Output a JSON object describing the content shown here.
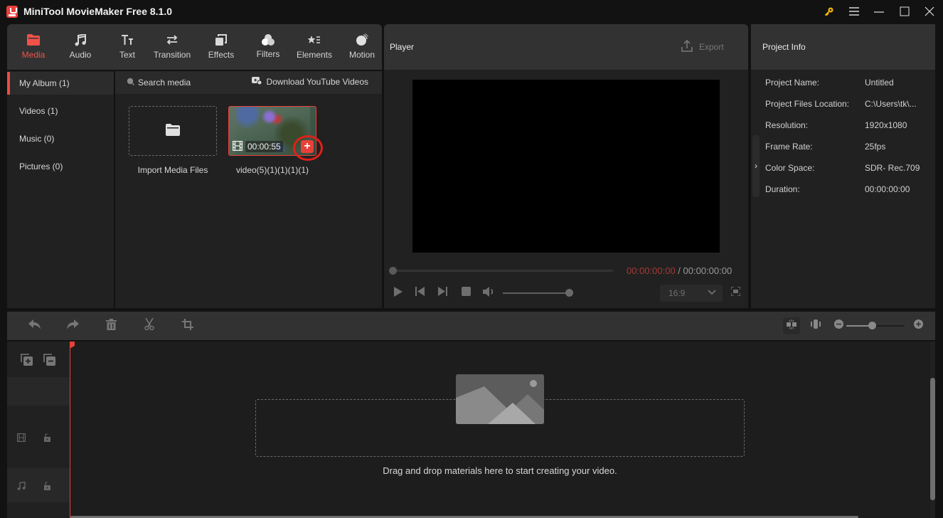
{
  "window": {
    "title": "MiniTool MovieMaker Free 8.1.0",
    "controls": [
      "key-icon",
      "menu-icon",
      "minimize-icon",
      "maximize-icon",
      "close-icon"
    ]
  },
  "toolbar": {
    "active": "Media",
    "tabs": [
      {
        "label": "Media",
        "icon": "folder-icon"
      },
      {
        "label": "Audio",
        "icon": "music-note-icon"
      },
      {
        "label": "Text",
        "icon": "text-icon"
      },
      {
        "label": "Transition",
        "icon": "transition-arrows-icon"
      },
      {
        "label": "Effects",
        "icon": "effects-icon"
      },
      {
        "label": "Filters",
        "icon": "filters-icon"
      },
      {
        "label": "Elements",
        "icon": "elements-icon"
      },
      {
        "label": "Motion",
        "icon": "motion-icon"
      }
    ]
  },
  "sidebar": {
    "items": [
      {
        "label": "My Album (1)",
        "active": true
      },
      {
        "label": "Videos (1)"
      },
      {
        "label": "Music (0)"
      },
      {
        "label": "Pictures (0)"
      }
    ]
  },
  "media": {
    "search_placeholder": "Search media",
    "download_label": "Download YouTube Videos",
    "import_label": "Import Media Files",
    "items": [
      {
        "name": "video(5)(1)(1)(1)(1)",
        "duration": "00:00:55",
        "add_label": "+"
      }
    ]
  },
  "player": {
    "title": "Player",
    "export_label": "Export",
    "current_time": "00:00:00:00",
    "separator": " / ",
    "total_time": "00:00:00:00",
    "aspect_ratio": "16:9",
    "volume_percent": 100,
    "progress_percent": 0
  },
  "project_info": {
    "title": "Project Info",
    "rows": [
      {
        "label": "Project Name:",
        "value": "Untitled"
      },
      {
        "label": "Project Files Location:",
        "value": "C:\\Users\\tk\\..."
      },
      {
        "label": "Resolution:",
        "value": "1920x1080"
      },
      {
        "label": "Frame Rate:",
        "value": "25fps"
      },
      {
        "label": "Color Space:",
        "value": "SDR- Rec.709"
      },
      {
        "label": "Duration:",
        "value": "00:00:00:00"
      }
    ]
  },
  "timeline": {
    "drop_hint": "Drag and drop materials here to start creating your video.",
    "zoom_percent": 40,
    "tools": [
      "undo",
      "redo",
      "delete",
      "split",
      "crop"
    ]
  },
  "colors": {
    "accent": "#e8403a",
    "panel": "#212121",
    "header": "#323232"
  }
}
